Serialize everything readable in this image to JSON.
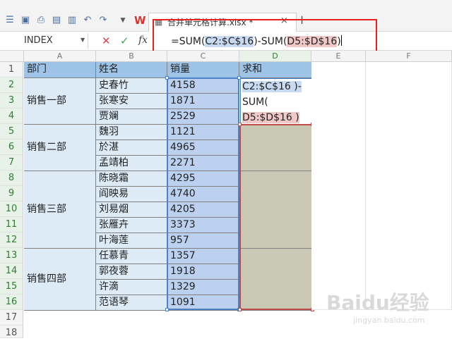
{
  "toolbar": {
    "logo_text": "W",
    "tab_title": "合并单元格计算.xlsx *",
    "tab_close": "×",
    "tab_add": "+"
  },
  "formula_bar": {
    "name_box": "INDEX",
    "formula": {
      "prefix": "=SUM(",
      "ref1": "C2:$C$16",
      "middle": ")-SUM(",
      "ref2": "D5:$D$16",
      "suffix": ")"
    }
  },
  "columns": [
    "A",
    "B",
    "C",
    "D",
    "E",
    "F"
  ],
  "rows": [
    "1",
    "2",
    "3",
    "4",
    "5",
    "6",
    "7",
    "8",
    "9",
    "10",
    "11",
    "12",
    "13",
    "14",
    "15",
    "16",
    "17",
    "18"
  ],
  "table": {
    "headers": {
      "dept": "部门",
      "name": "姓名",
      "sales": "销量",
      "sum": "求和"
    },
    "departments": [
      "销售一部",
      "销售二部",
      "销售三部",
      "销售四部"
    ],
    "names": [
      "史春竹",
      "张寒安",
      "贾斓",
      "魏羽",
      "於湛",
      "孟靖柏",
      "陈晓霜",
      "阎映易",
      "刘易烟",
      "张雁卉",
      "叶海莲",
      "任慕青",
      "郭夜蓉",
      "许滴",
      "范语琴"
    ],
    "sales": [
      "4158",
      "1871",
      "2529",
      "1121",
      "4965",
      "2271",
      "4295",
      "4740",
      "4205",
      "3373",
      "957",
      "1357",
      "1918",
      "1329",
      "1091"
    ]
  },
  "edit_cell": {
    "line1": "C2:$C$16 )-",
    "line2": "SUM(",
    "line3": "D5:$D$16 )"
  },
  "watermark": {
    "main": "Baidu经验",
    "sub": "jingyan.baidu.com"
  }
}
